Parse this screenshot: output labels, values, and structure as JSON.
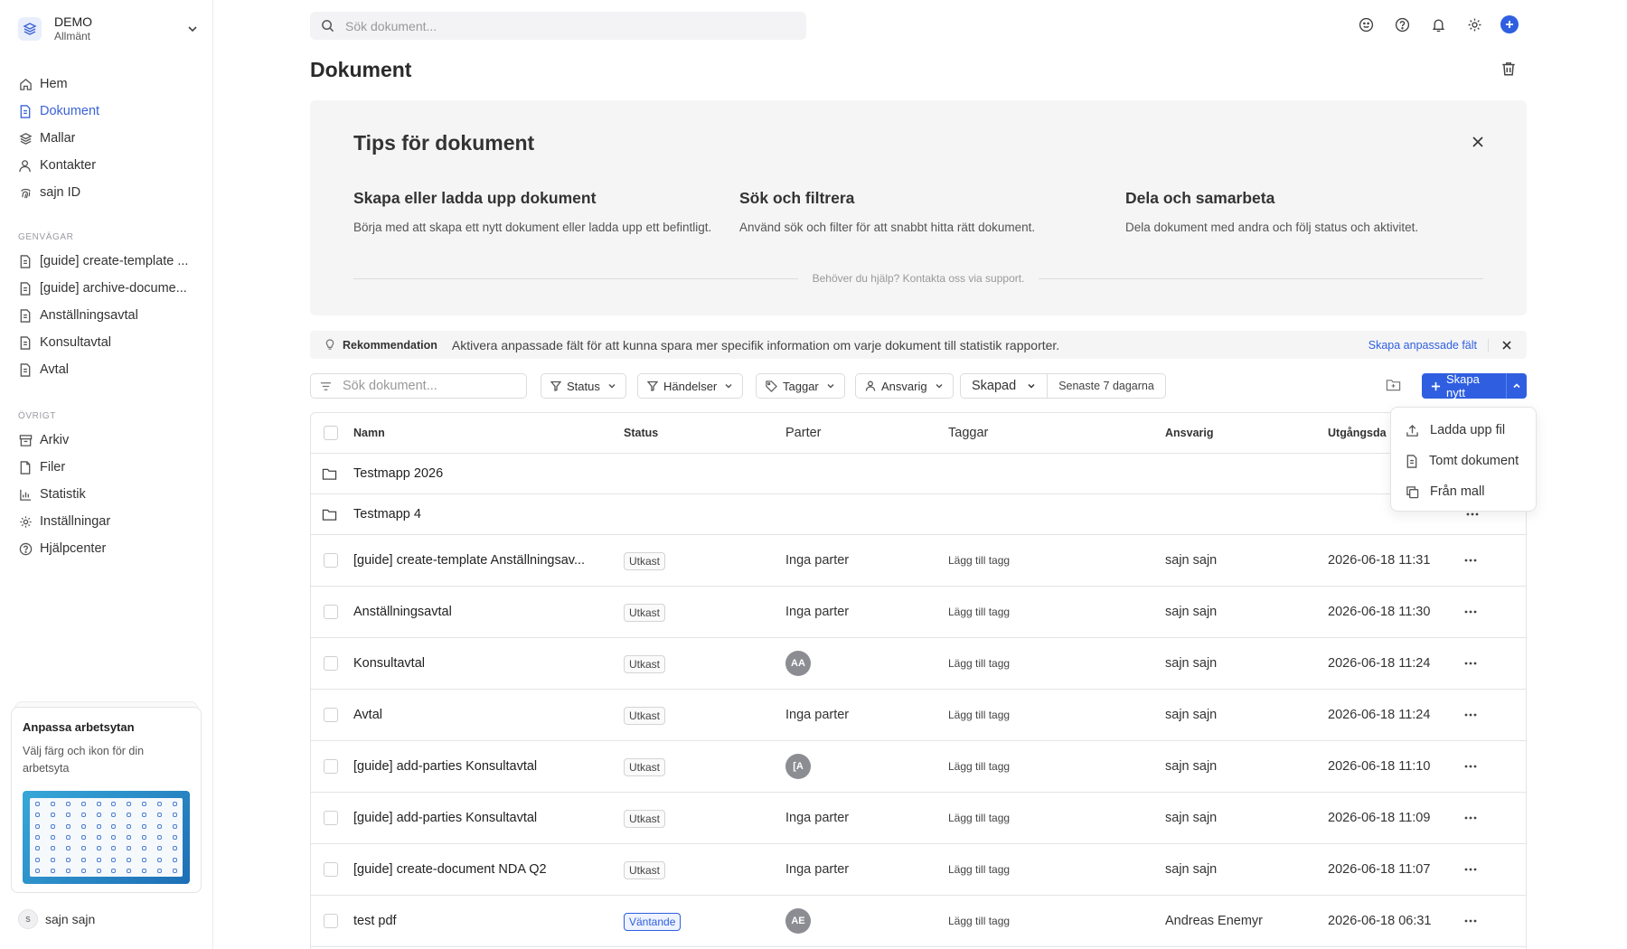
{
  "workspace": {
    "name": "DEMO",
    "subtitle": "Allmänt"
  },
  "nav": [
    {
      "label": "Hem",
      "icon": "home-icon"
    },
    {
      "label": "Dokument",
      "icon": "document-icon",
      "active": true
    },
    {
      "label": "Mallar",
      "icon": "layers-icon"
    },
    {
      "label": "Kontakter",
      "icon": "contacts-icon"
    },
    {
      "label": "sajn ID",
      "icon": "fingerprint-icon"
    }
  ],
  "shortcuts": {
    "label": "GENVÄGAR",
    "items": [
      "[guide] create-template ...",
      "[guide] archive-docume...",
      "Anställningsavtal",
      "Konsultavtal",
      "Avtal"
    ]
  },
  "other": {
    "label": "ÖVRIGT",
    "items": [
      {
        "label": "Arkiv",
        "icon": "archive-icon"
      },
      {
        "label": "Filer",
        "icon": "file-icon"
      },
      {
        "label": "Statistik",
        "icon": "chart-icon"
      },
      {
        "label": "Inställningar",
        "icon": "gear-icon"
      },
      {
        "label": "Hjälpcenter",
        "icon": "help-icon"
      }
    ]
  },
  "promo": {
    "title": "Anpassa arbetsytan",
    "desc": "Välj färg och ikon för din arbetsyta"
  },
  "user": {
    "initial": "s",
    "name": "sajn sajn"
  },
  "topbar": {
    "search_placeholder": "Sök dokument..."
  },
  "page": {
    "title": "Dokument"
  },
  "tips": {
    "title": "Tips för dokument",
    "items": [
      {
        "title": "Skapa eller ladda upp dokument",
        "desc": "Börja med att skapa ett nytt dokument eller ladda upp ett befintligt."
      },
      {
        "title": "Sök och filtrera",
        "desc": "Använd sök och filter för att snabbt hitta rätt dokument."
      },
      {
        "title": "Dela och samarbeta",
        "desc": "Dela dokument med andra och följ status och aktivitet."
      }
    ],
    "footer": "Behöver du hjälp? Kontakta oss via support."
  },
  "recommendation": {
    "label": "Rekommendation",
    "text": "Aktivera anpassade fält för att kunna spara mer specifik information om varje dokument till statistik rapporter.",
    "link": "Skapa anpassade fält"
  },
  "filters": {
    "search_placeholder": "Sök dokument...",
    "status": "Status",
    "events": "Händelser",
    "tags": "Taggar",
    "responsible": "Ansvarig",
    "created": "Skapad",
    "range": "Senaste 7 dagarna",
    "create": "Skapa nytt"
  },
  "create_menu": [
    "Ladda upp fil",
    "Tomt dokument",
    "Från mall"
  ],
  "table": {
    "headers": {
      "name": "Namn",
      "status": "Status",
      "parter": "Parter",
      "tags": "Taggar",
      "responsible": "Ansvarig",
      "expiry": "Utgångsda"
    },
    "folders": [
      "Testmapp 2026",
      "Testmapp 4"
    ],
    "rows": [
      {
        "name": "[guide] create-template Anställningsav...",
        "status": "Utkast",
        "parter": "Inga parter",
        "tag": "Lägg till tagg",
        "resp": "sajn sajn",
        "date": "2026-06-18 11:31"
      },
      {
        "name": "Anställningsavtal",
        "status": "Utkast",
        "parter": "Inga parter",
        "tag": "Lägg till tagg",
        "resp": "sajn sajn",
        "date": "2026-06-18 11:30"
      },
      {
        "name": "Konsultavtal",
        "status": "Utkast",
        "avatar": "AA",
        "tag": "Lägg till tagg",
        "resp": "sajn sajn",
        "date": "2026-06-18 11:24"
      },
      {
        "name": "Avtal",
        "status": "Utkast",
        "parter": "Inga parter",
        "tag": "Lägg till tagg",
        "resp": "sajn sajn",
        "date": "2026-06-18 11:24"
      },
      {
        "name": "[guide] add-parties Konsultavtal",
        "status": "Utkast",
        "avatar": "[A",
        "tag": "Lägg till tagg",
        "resp": "sajn sajn",
        "date": "2026-06-18 11:10"
      },
      {
        "name": "[guide] add-parties Konsultavtal",
        "status": "Utkast",
        "parter": "Inga parter",
        "tag": "Lägg till tagg",
        "resp": "sajn sajn",
        "date": "2026-06-18 11:09"
      },
      {
        "name": "[guide] create-document NDA Q2",
        "status": "Utkast",
        "parter": "Inga parter",
        "tag": "Lägg till tagg",
        "resp": "sajn sajn",
        "date": "2026-06-18 11:07"
      },
      {
        "name": "test pdf",
        "status": "Väntande",
        "pending": true,
        "avatar": "AE",
        "tag": "Lägg till tagg",
        "resp": "Andreas Enemyr",
        "date": "2026-06-18 06:31"
      }
    ]
  }
}
